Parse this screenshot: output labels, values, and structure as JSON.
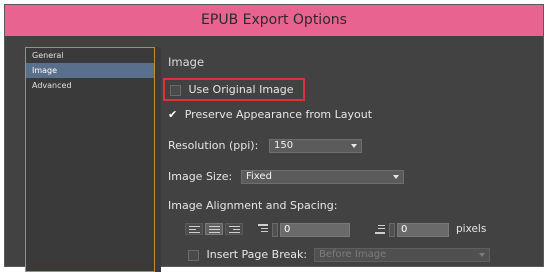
{
  "window": {
    "title": "EPUB Export Options"
  },
  "sidebar": {
    "items": [
      {
        "label": "General"
      },
      {
        "label": "Image"
      },
      {
        "label": "Advanced"
      }
    ]
  },
  "image": {
    "section_title": "Image",
    "use_original": {
      "label": "Use Original Image",
      "checked": false
    },
    "preserve": {
      "label": "Preserve Appearance from Layout",
      "checked": true,
      "checkmark": "✔"
    },
    "resolution": {
      "label": "Resolution (ppi):",
      "value": "150"
    },
    "size": {
      "label": "Image Size:",
      "value": "Fixed"
    },
    "alignment": {
      "label": "Image Alignment and Spacing:"
    },
    "spacing_before": "0",
    "spacing_after": "0",
    "units": "pixels",
    "page_break": {
      "label": "Insert Page Break:",
      "value": "Before Image",
      "checked": false
    }
  }
}
